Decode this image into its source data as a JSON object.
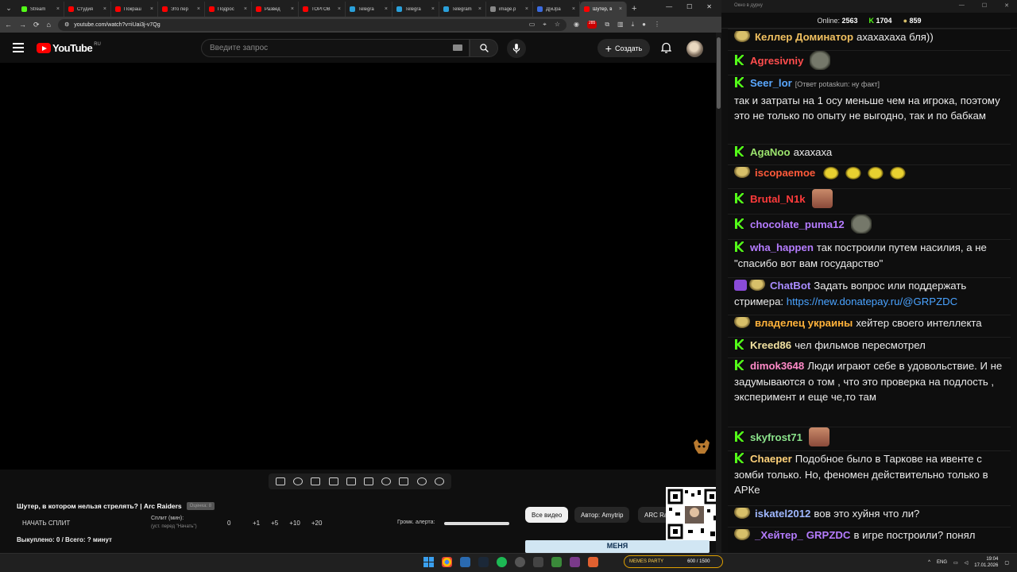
{
  "browser": {
    "tabs": [
      {
        "label": "Stream",
        "color": "#53fc18"
      },
      {
        "label": "Студия",
        "color": "#ff0000"
      },
      {
        "label": "Покраш",
        "color": "#ff0000"
      },
      {
        "label": "Это пер",
        "color": "#ff0000"
      },
      {
        "label": "Подрос",
        "color": "#ff0000"
      },
      {
        "label": "Развед",
        "color": "#ff0000"
      },
      {
        "label": "ТОРГОВ",
        "color": "#ff0000"
      },
      {
        "label": "Telegra",
        "color": "#2aa0da"
      },
      {
        "label": "Telegra",
        "color": "#2aa0da"
      },
      {
        "label": "Telegram",
        "color": "#2aa0da"
      },
      {
        "label": "image.p",
        "color": "#888888"
      },
      {
        "label": "Д[иЈра",
        "color": "#3a6adf"
      },
      {
        "label": "Шутер, в",
        "color": "#ff0000",
        "active": true
      }
    ],
    "new_tab": "+",
    "url": "youtube.com/watch?v=iUai3j-v7Qg",
    "ext_badge": "285"
  },
  "youtube": {
    "logo_text": "YouTube",
    "region": "RU",
    "search_placeholder": "Введите запрос",
    "create_label": "Создать"
  },
  "under_video": {
    "title": "Шутер, в котором нельзя стрелять? | Arc Raiders",
    "tag": "Оценка: 8",
    "start_split": "НАЧАТЬ СПЛИТ",
    "split_label": "Сплит (мин):",
    "split_hint": "(уст. перед \"Начать\")",
    "split_value": "0",
    "increments": [
      "+1",
      "+5",
      "+10",
      "+20"
    ],
    "alert_volume_label": "Громк. алерта:",
    "alert_volume": 1.0,
    "bought": "Выкуплено: 0 / Всего: ? минут",
    "chips": [
      "Все видео",
      "Автор: Amytrip",
      "ARC Raiders"
    ],
    "banner_text": "МЕНЯ"
  },
  "chat": {
    "window_title": "Окно в дурку",
    "online_label": "Online:",
    "online": "2563",
    "kick_count": "1704",
    "other_count": "859",
    "messages": [
      {
        "user": "Келлер Доминатор",
        "color": "#f0c060",
        "badge": "face",
        "text": "ахахахаха бля))"
      },
      {
        "user": "Agresivniy",
        "color": "#ff4d4d",
        "badge": "kick",
        "text": "",
        "emote": "seal"
      },
      {
        "user": "Seer_lor",
        "color": "#5aa8ff",
        "badge": "kick",
        "reply": "[Ответ potaskun: ну факт]",
        "text": "так и затраты на 1 осу меньше чем на игрока, поэтому это не только по опыту не выгодно, так и по бабкам"
      },
      {
        "user": "AgaNoo",
        "color": "#9be36d",
        "badge": "kick",
        "text": "ахахаха"
      },
      {
        "user": "iscopaemoe",
        "color": "#ff5a3a",
        "badge": "face",
        "text": "",
        "emote": "birds"
      },
      {
        "user": "Brutal_N1k",
        "color": "#ff3b3b",
        "badge": "kick",
        "text": "",
        "emote": "face2"
      },
      {
        "user": "chocolate_puma12",
        "color": "#b57cff",
        "badge": "kick",
        "text": "",
        "emote": "seal"
      },
      {
        "user": "wha_happen",
        "color": "#b57cff",
        "badge": "kick",
        "text": "так построили путем насилия, а не \"спасибо вот вам государство\""
      },
      {
        "user": "ChatBot",
        "color": "#a98cff",
        "badge": "bot",
        "text": "Задать вопрос или поддержать стримера:",
        "link": "https://new.donatepay.ru/@GRPZDC"
      },
      {
        "user": "владелец украины",
        "color": "#ffb23a",
        "badge": "face",
        "text": "хейтер своего интеллекта"
      },
      {
        "user": "Kreed86",
        "color": "#f0e0a0",
        "badge": "kick",
        "text": "чел фильмов пересмотрел"
      },
      {
        "user": "dimok3648",
        "color": "#ff8ac8",
        "badge": "kick",
        "text": "Люди играют себе в удовольствие. И не задумываются о том , что это проверка на подлость , эксперимент и еще че,то там"
      },
      {
        "user": "skyfrost71",
        "color": "#8be38b",
        "badge": "kick",
        "text": "",
        "emote": "face2"
      },
      {
        "user": "Chaeper",
        "color": "#ffd27a",
        "badge": "kick",
        "text": "Подобное было в Таркове на ивенте с зомби только. Но, феномен действительно только в АРКе"
      },
      {
        "user": "iskatel2012",
        "color": "#a0b8ff",
        "badge": "face",
        "text": "вов это хуйня что ли?"
      },
      {
        "user": "_Хейтер_",
        "color": "#b57cff",
        "badge": "face",
        "mention": "GRPZDC",
        "text": "в игре построили? понял"
      }
    ]
  },
  "taskbar": {
    "lang": "ENG",
    "time": "19:04",
    "date": "17.01.2026",
    "memes_label": "MEMES PARTY",
    "memes_count": "600 / 1500"
  }
}
